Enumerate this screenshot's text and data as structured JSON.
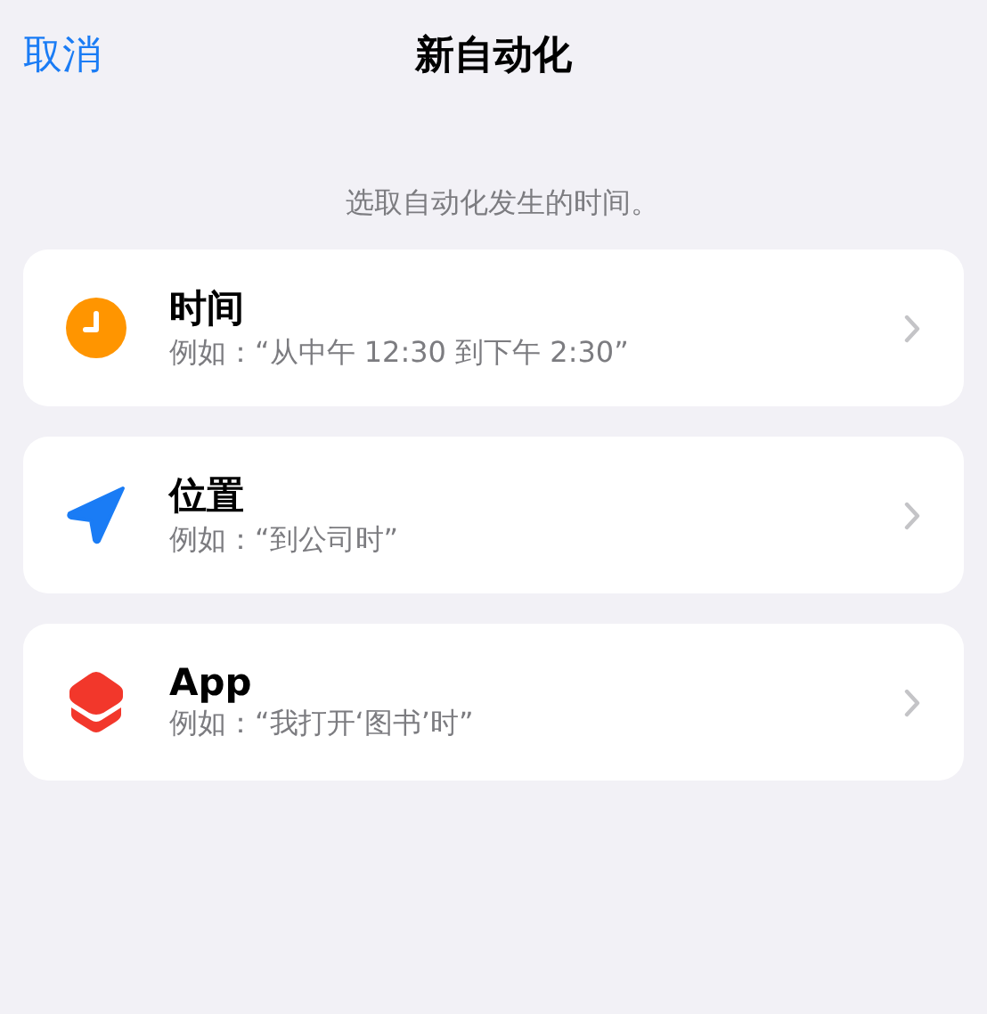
{
  "nav": {
    "cancel": "取消",
    "title": "新自动化"
  },
  "prompt": "选取自动化发生的时间。",
  "options": [
    {
      "kind": "time",
      "title": "时间",
      "example": "例如：“从中午 12:30 到下午 2:30”"
    },
    {
      "kind": "location",
      "title": "位置",
      "example": "例如：“到公司时”"
    },
    {
      "kind": "app",
      "title": "App",
      "example": "例如：“我打开‘图书’时”"
    }
  ]
}
